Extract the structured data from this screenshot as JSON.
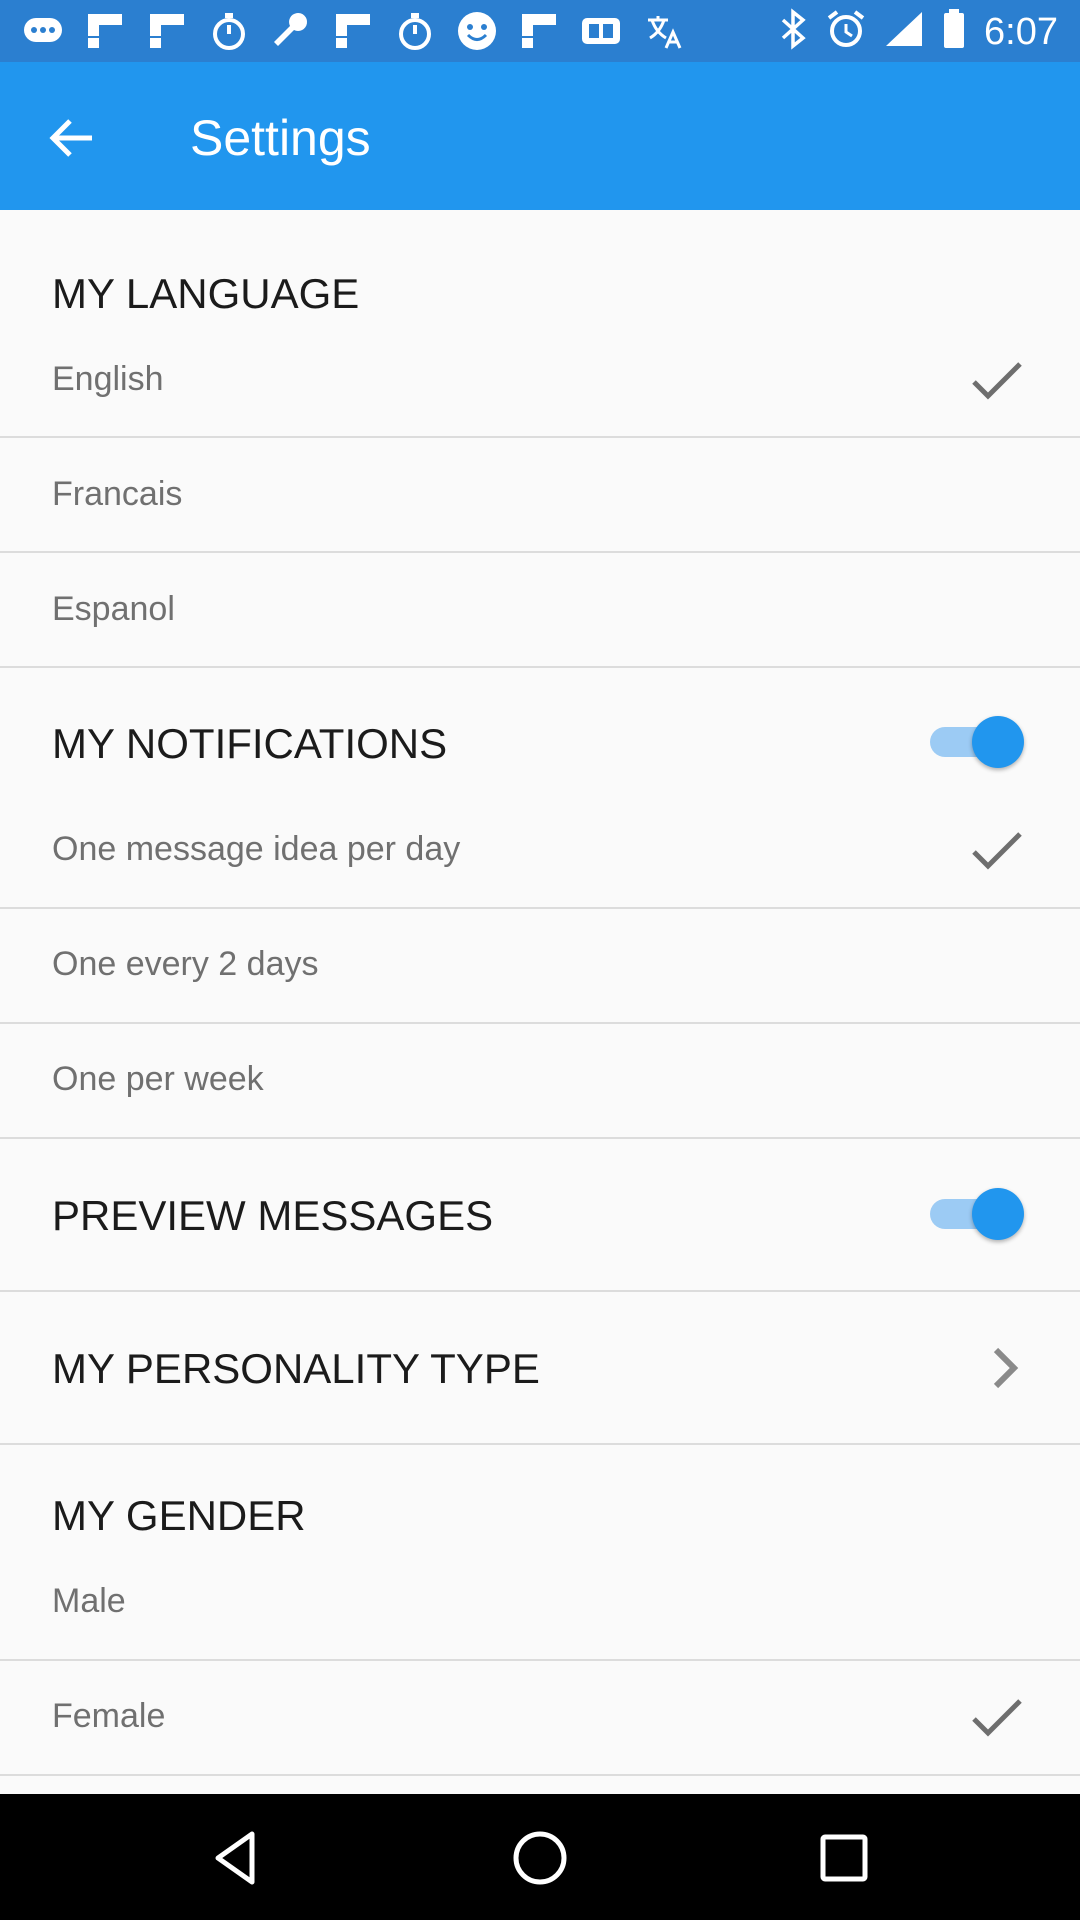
{
  "status_bar": {
    "time": "6:07",
    "left_icons": [
      "chat-bubbles-icon",
      "flipboard-icon",
      "flipboard-icon",
      "stopwatch-icon",
      "wrench-icon",
      "flipboard-icon",
      "stopwatch-icon",
      "smiley-icon",
      "flipboard-icon",
      "qt-app-icon",
      "translate-icon"
    ],
    "right_icons": [
      "bluetooth-icon",
      "alarm-icon",
      "signal-icon",
      "battery-icon"
    ]
  },
  "app_bar": {
    "title": "Settings",
    "back_icon": "arrow-back-icon"
  },
  "colors": {
    "app_bar": "#2196ee",
    "status_bar": "#2b7fd0",
    "accent": "#2196ee"
  },
  "language": {
    "header": "MY LANGUAGE",
    "options": [
      {
        "label": "English",
        "selected": true
      },
      {
        "label": "Francais",
        "selected": false
      },
      {
        "label": "Espanol",
        "selected": false
      }
    ]
  },
  "notifications": {
    "header": "MY NOTIFICATIONS",
    "enabled": true,
    "options": [
      {
        "label": "One message idea per day",
        "selected": true
      },
      {
        "label": "One every 2 days",
        "selected": false
      },
      {
        "label": "One per week",
        "selected": false
      }
    ]
  },
  "preview": {
    "header": "PREVIEW MESSAGES",
    "enabled": true
  },
  "personality": {
    "header": "MY PERSONALITY TYPE"
  },
  "gender": {
    "header": "MY GENDER",
    "options": [
      {
        "label": "Male",
        "selected": false
      },
      {
        "label": "Female",
        "selected": true
      }
    ]
  },
  "nav_bar": [
    "back-triangle-icon",
    "home-circle-icon",
    "recents-square-icon"
  ]
}
